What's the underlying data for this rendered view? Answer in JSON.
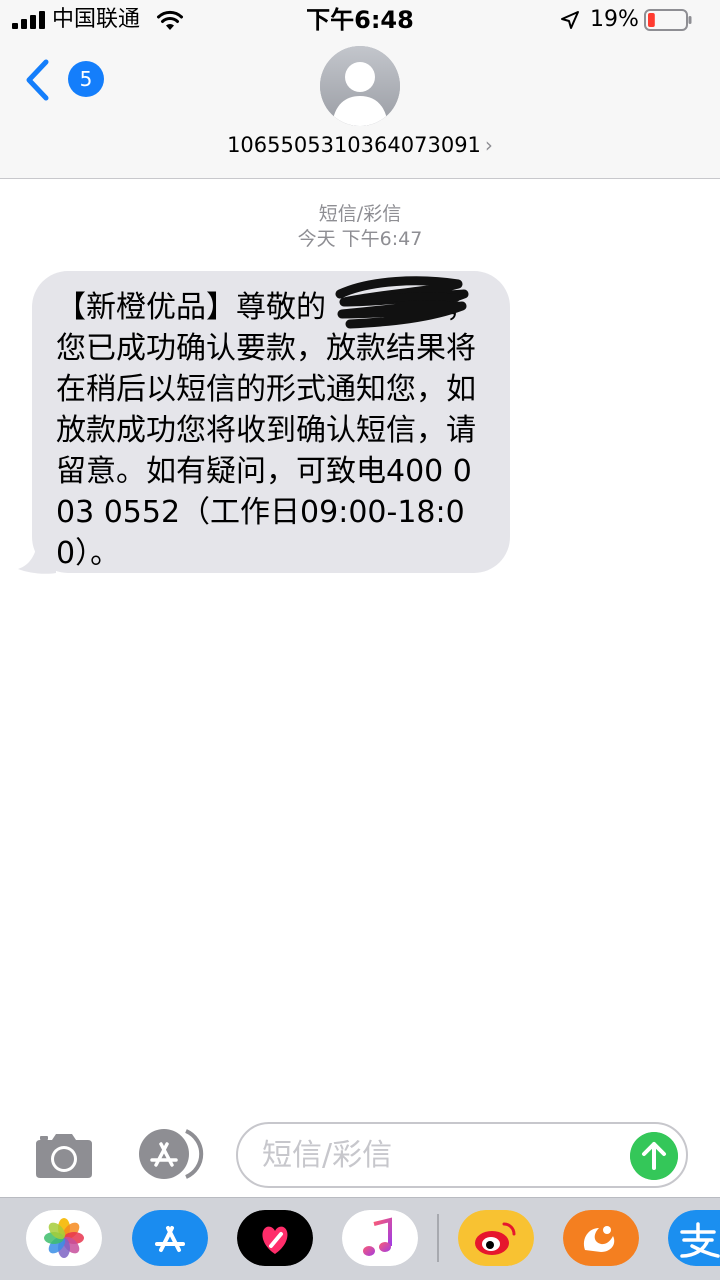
{
  "status_bar": {
    "carrier": "中国联通",
    "time": "下午6:48",
    "battery_percent": "19%",
    "battery_level": 0.19,
    "icons": [
      "signal-icon",
      "wifi-icon",
      "location-arrow-icon",
      "battery-icon"
    ]
  },
  "header": {
    "back_badge_count": "5",
    "contact_number": "1065505310364073091",
    "icons": [
      "back-chevron-icon",
      "contact-avatar-icon",
      "chevron-right-icon"
    ]
  },
  "thread": {
    "message_type": "短信/彩信",
    "timestamp": "今天 下午6:47",
    "messages": [
      {
        "direction": "incoming",
        "text": "【新橙优品】尊敬的　　　　，您已成功确认要款，放款结果将在稍后以短信的形式通知您，如放款成功您将收到确认短信，请留意。如有疑问，可致电400 003 0552（工作日09:00-18:00）。",
        "redacted": true
      }
    ]
  },
  "input_bar": {
    "placeholder": "短信/彩信",
    "value": "",
    "icons": [
      "camera-icon",
      "app-store-icon",
      "send-arrow-icon"
    ]
  },
  "app_drawer": {
    "apps": [
      "photos-icon",
      "app-store-icon",
      "digital-touch-icon",
      "music-icon",
      "weibo-icon",
      "uc-browser-icon",
      "alipay-icon"
    ],
    "colors": {
      "accent_blue": "#147efb",
      "send_green": "#34c759",
      "bubble_gray": "#e5e5ea",
      "battery_red": "#ff3b30"
    }
  }
}
